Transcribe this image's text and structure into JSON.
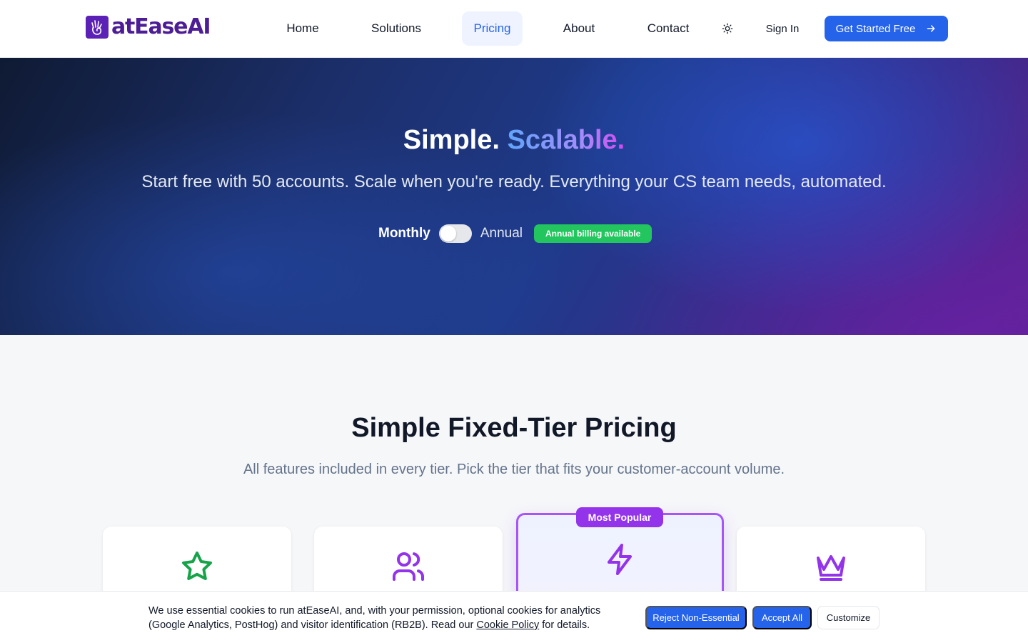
{
  "header": {
    "logo_text": "atEaseAI",
    "nav": [
      {
        "label": "Home",
        "active": false
      },
      {
        "label": "Solutions",
        "active": false
      },
      {
        "label": "Pricing",
        "active": true
      },
      {
        "label": "About",
        "active": false
      },
      {
        "label": "Contact",
        "active": false
      }
    ],
    "theme_toggle_icon": "sun-icon",
    "sign_in": "Sign In",
    "cta": "Get Started Free",
    "cta_icon": "arrow-right-icon"
  },
  "hero": {
    "title_plain": "Simple.",
    "title_highlight": "Scalable.",
    "subtitle": "Start free with 50 accounts. Scale when you're ready. Everything your CS team needs, automated.",
    "billing": {
      "monthly_label": "Monthly",
      "annual_label": "Annual",
      "badge": "Annual billing available",
      "selected": "Monthly"
    }
  },
  "pricing": {
    "title": "Simple Fixed-Tier Pricing",
    "subtitle": "All features included in every tier. Pick the tier that fits your customer-account volume.",
    "tiers": [
      {
        "icon": "star-icon",
        "color": "#16a34a",
        "popular": false
      },
      {
        "icon": "users-icon",
        "color": "#9333ea",
        "popular": false
      },
      {
        "icon": "lightning-icon",
        "color": "#9333ea",
        "popular": true
      },
      {
        "icon": "crown-icon",
        "color": "#9333ea",
        "popular": false
      }
    ],
    "popular_badge": "Most Popular"
  },
  "cookie_banner": {
    "text": "We use essential cookies to run atEaseAI, and, with your permission, optional cookies for analytics (Google Analytics, PostHog) and visitor identification (RB2B). Read our",
    "link": "Cookie Policy",
    "text_after": "for details.",
    "reject": "Reject Non-Essential",
    "accept": "Accept All",
    "customize": "Customize"
  },
  "colors": {
    "brand": "#4c1d95",
    "primary": "#2563eb",
    "success": "#22c55e",
    "popular": "#9333ea"
  }
}
